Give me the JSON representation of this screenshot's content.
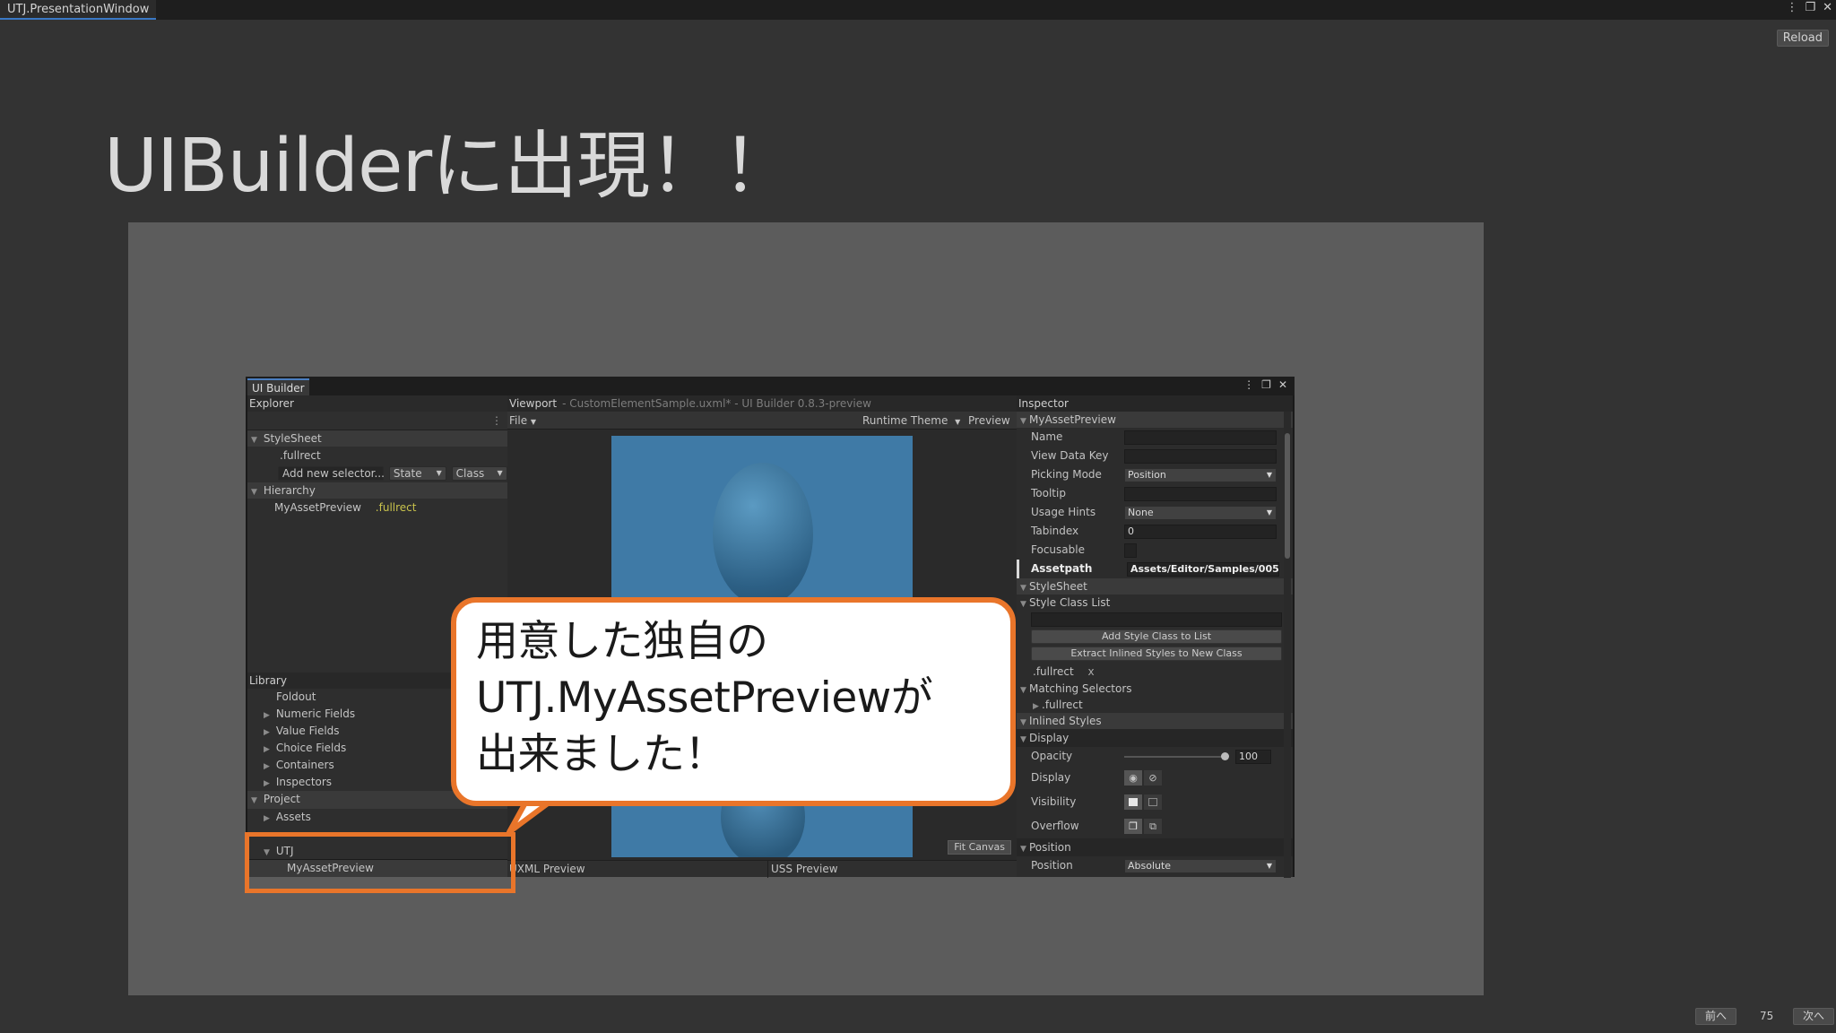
{
  "window": {
    "title": "UTJ.PresentationWindow",
    "reload_label": "Reload",
    "more_icon": "⋮",
    "max_icon": "❐",
    "close_icon": "✕"
  },
  "slide": {
    "title": "UIBuilderに出現！！",
    "page_number": "75",
    "prev_label": "前へ",
    "next_label": "次へ"
  },
  "ui_builder": {
    "tab_label": "UI Builder",
    "explorer": {
      "header": "Explorer",
      "stylesheet_label": "StyleSheet",
      "selector_item": ".fullrect",
      "add_selector_placeholder": "Add new selector...",
      "state_label": "State",
      "class_label": "Class",
      "hierarchy_label": "Hierarchy",
      "hierarchy_item": "MyAssetPreview",
      "hierarchy_item_class": ".fullrect"
    },
    "library": {
      "header": "Library",
      "items": [
        "Foldout",
        "Numeric Fields",
        "Value Fields",
        "Choice Fields",
        "Containers",
        "Inspectors"
      ],
      "project_label": "Project",
      "assets_label": "Assets",
      "utj_label": "UTJ",
      "utj_item": "MyAssetPreview"
    },
    "viewport": {
      "header": "Viewport",
      "document": "- CustomElementSample.uxml* - UI Builder 0.8.3-preview",
      "file_menu": "File",
      "theme_label": "Runtime Theme",
      "preview_label": "Preview",
      "fit_canvas_label": "Fit Canvas",
      "uxml_preview_label": "UXML Preview",
      "uss_preview_label": "USS Preview"
    },
    "inspector": {
      "header": "Inspector",
      "element_name": "MyAssetPreview",
      "fields": {
        "name_label": "Name",
        "view_data_key_label": "View Data Key",
        "picking_mode_label": "Picking Mode",
        "picking_mode_value": "Position",
        "tooltip_label": "Tooltip",
        "usage_hints_label": "Usage Hints",
        "usage_hints_value": "None",
        "tabindex_label": "Tabindex",
        "tabindex_value": "0",
        "focusable_label": "Focusable",
        "assetpath_label": "Assetpath",
        "assetpath_value": "Assets/Editor/Samples/005"
      },
      "stylesheet_label": "StyleSheet",
      "style_class_list_label": "Style Class List",
      "add_style_class_button": "Add Style Class to List",
      "extract_button": "Extract Inlined Styles to New Class",
      "class_chip": ".fullrect",
      "class_chip_remove": "x",
      "matching_selectors_label": "Matching Selectors",
      "matching_selector_item": ".fullrect",
      "inlined_styles_label": "Inlined Styles",
      "display_section_label": "Display",
      "opacity_label": "Opacity",
      "opacity_value": "100",
      "display_label": "Display",
      "visibility_label": "Visibility",
      "overflow_label": "Overflow",
      "position_section_label": "Position",
      "position_label": "Position",
      "position_value": "Absolute"
    }
  },
  "callout": {
    "text": "用意した独自の\nUTJ.MyAssetPreviewが\n出来ました！"
  },
  "colors": {
    "accent_orange": "#e9752a",
    "canvas_blue": "#3f7aa6",
    "tab_blue": "#3a78c5"
  }
}
